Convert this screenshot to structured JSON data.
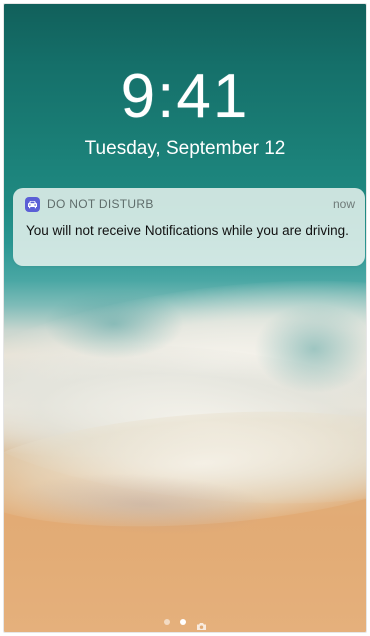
{
  "lock_screen": {
    "time": "9:41",
    "date": "Tuesday, September 12"
  },
  "notification": {
    "app_icon": "car-icon",
    "app_name": "DO NOT DISTURB",
    "timestamp": "now",
    "message": "You will not receive Notifications while you are driving.",
    "icon_color": "#5b5fd6"
  },
  "page_indicator": {
    "pages": [
      "dot",
      "dot-active",
      "camera-icon"
    ]
  }
}
